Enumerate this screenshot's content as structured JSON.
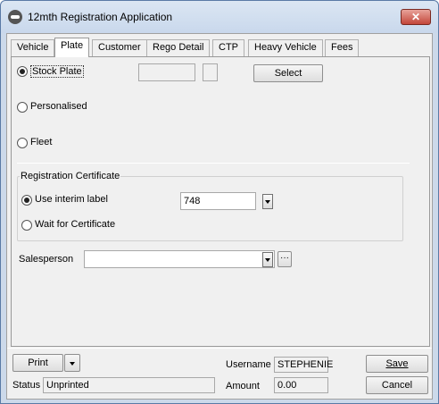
{
  "window": {
    "title": "12mth Registration Application",
    "close_label": "✕"
  },
  "tabs": [
    {
      "label": "Vehicle",
      "active": false
    },
    {
      "label": "Plate",
      "active": true
    },
    {
      "label": "Customer",
      "active": false
    },
    {
      "label": "Rego Detail",
      "active": false
    },
    {
      "label": "CTP",
      "active": false
    },
    {
      "label": "Heavy Vehicle",
      "active": false
    },
    {
      "label": "Fees",
      "active": false
    }
  ],
  "plate": {
    "stock_plate_label": "Stock Plate",
    "personalised_label": "Personalised",
    "fleet_label": "Fleet",
    "select_label": "Select",
    "plate_value": "",
    "plate_suffix": ""
  },
  "certificate": {
    "group_label": "Registration Certificate",
    "use_interim_label": "Use interim label",
    "wait_label": "Wait for Certificate",
    "interim_value": "748"
  },
  "salesperson": {
    "label": "Salesperson",
    "value": "",
    "browse_label": "···"
  },
  "footer": {
    "print_label": "Print",
    "status_label": "Status",
    "status_value": "Unprinted",
    "username_label": "Username",
    "username_value": "STEPHENIE",
    "amount_label": "Amount",
    "amount_value": "0.00",
    "save_label": "Save",
    "cancel_label": "Cancel"
  }
}
